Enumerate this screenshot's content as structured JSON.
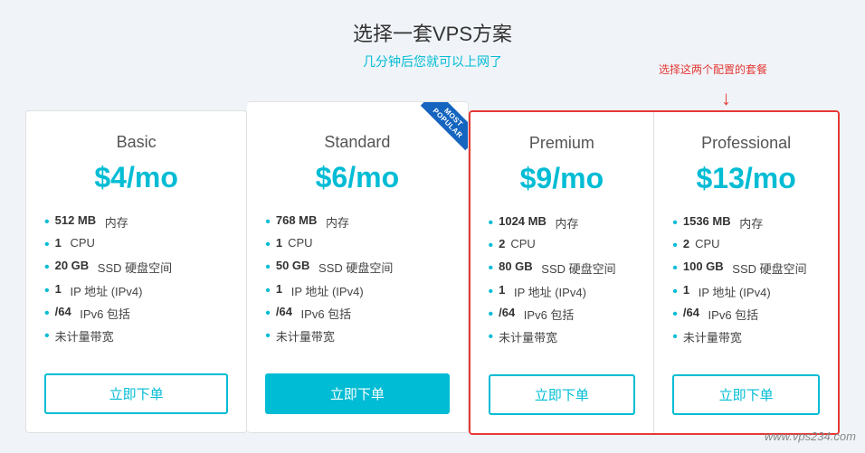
{
  "header": {
    "title": "选择一套VPS方案",
    "subtitle": "几分钟后您就可以上网了",
    "annotation": "选择这两个配置的套餐"
  },
  "plans": [
    {
      "id": "basic",
      "name": "Basic",
      "price": "$4/mo",
      "badge": null,
      "features": [
        {
          "bold": "512 MB",
          "text": " 内存"
        },
        {
          "bold": "1",
          "text": " CPU"
        },
        {
          "bold": "20 GB",
          "text": " SSD 硬盘空间"
        },
        {
          "bold": "1",
          "text": " IP 地址 (IPv4)"
        },
        {
          "bold": "/64",
          "text": " IPv6 包括"
        },
        {
          "bold": "",
          "text": "未计量带宽"
        }
      ],
      "btn_label": "立即下单",
      "btn_filled": false,
      "highlighted": false
    },
    {
      "id": "standard",
      "name": "Standard",
      "price": "$6/mo",
      "badge": "MOST POPULAR",
      "features": [
        {
          "bold": "768 MB",
          "text": " 内存"
        },
        {
          "bold": "1",
          "text": "CPU"
        },
        {
          "bold": "50 GB",
          "text": " SSD 硬盘空间"
        },
        {
          "bold": "1",
          "text": " IP 地址 (IPv4)"
        },
        {
          "bold": "/64",
          "text": " IPv6 包括"
        },
        {
          "bold": "",
          "text": "未计量带宽"
        }
      ],
      "btn_label": "立即下单",
      "btn_filled": true,
      "highlighted": false
    },
    {
      "id": "premium",
      "name": "Premium",
      "price": "$9/mo",
      "badge": null,
      "features": [
        {
          "bold": "1024 MB",
          "text": " 内存"
        },
        {
          "bold": "2",
          "text": "CPU"
        },
        {
          "bold": "80 GB",
          "text": " SSD 硬盘空间"
        },
        {
          "bold": "1",
          "text": " IP 地址 (IPv4)"
        },
        {
          "bold": "/64",
          "text": " IPv6 包括"
        },
        {
          "bold": "",
          "text": "未计量带宽"
        }
      ],
      "btn_label": "立即下单",
      "btn_filled": false,
      "highlighted": true
    },
    {
      "id": "professional",
      "name": "Professional",
      "price": "$13/mo",
      "badge": null,
      "features": [
        {
          "bold": "1536 MB",
          "text": " 内存"
        },
        {
          "bold": "2",
          "text": "CPU"
        },
        {
          "bold": "100 GB",
          "text": " SSD 硬盘空间"
        },
        {
          "bold": "1",
          "text": " IP 地址 (IPv4)"
        },
        {
          "bold": "/64",
          "text": " IPv6 包括"
        },
        {
          "bold": "",
          "text": "未计量带宽"
        }
      ],
      "btn_label": "立即下单",
      "btn_filled": false,
      "highlighted": true
    }
  ],
  "watermark": "www.vps234.com"
}
